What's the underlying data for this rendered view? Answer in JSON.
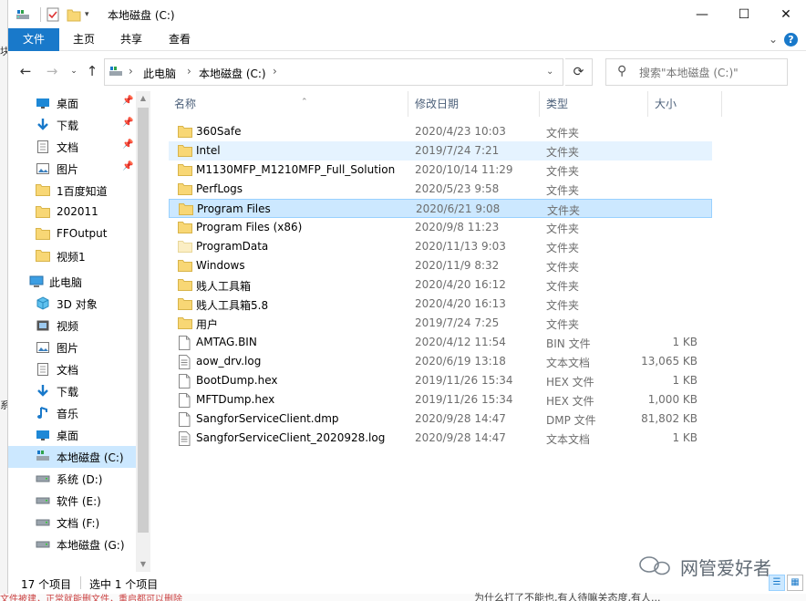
{
  "window": {
    "title": "本地磁盘 (C:)",
    "controls": {
      "minimize": "—",
      "maximize": "☐",
      "close": "✕"
    }
  },
  "ribbon": {
    "tabs": [
      "文件",
      "主页",
      "共享",
      "查看"
    ],
    "expand_glyph": "⌄",
    "help_glyph": "?"
  },
  "address": {
    "segments": [
      "此电脑",
      "本地磁盘 (C:)"
    ],
    "search_placeholder": "搜索\"本地磁盘 (C:)\""
  },
  "nav_pane": {
    "quick_access": [
      {
        "label": "桌面",
        "icon": "desktop-icon",
        "pinned": true
      },
      {
        "label": "下载",
        "icon": "download-icon",
        "pinned": true
      },
      {
        "label": "文档",
        "icon": "document-icon",
        "pinned": true
      },
      {
        "label": "图片",
        "icon": "picture-icon",
        "pinned": true
      },
      {
        "label": "1百度知道",
        "icon": "folder-icon",
        "pinned": false
      },
      {
        "label": "202011",
        "icon": "folder-icon",
        "pinned": false
      },
      {
        "label": "FFOutput",
        "icon": "folder-icon",
        "pinned": false
      },
      {
        "label": "视频1",
        "icon": "folder-icon",
        "pinned": false
      }
    ],
    "this_pc": {
      "label": "此电脑",
      "icon": "computer-icon"
    },
    "this_pc_items": [
      {
        "label": "3D 对象",
        "icon": "3d-objects-icon"
      },
      {
        "label": "视频",
        "icon": "video-icon"
      },
      {
        "label": "图片",
        "icon": "picture-icon"
      },
      {
        "label": "文档",
        "icon": "document-icon"
      },
      {
        "label": "下载",
        "icon": "download-icon"
      },
      {
        "label": "音乐",
        "icon": "music-icon"
      },
      {
        "label": "桌面",
        "icon": "desktop-icon"
      },
      {
        "label": "本地磁盘 (C:)",
        "icon": "system-drive-icon",
        "selected": true
      },
      {
        "label": "系统 (D:)",
        "icon": "drive-icon"
      },
      {
        "label": "软件 (E:)",
        "icon": "drive-icon"
      },
      {
        "label": "文档 (F:)",
        "icon": "drive-icon"
      },
      {
        "label": "本地磁盘 (G:)",
        "icon": "drive-icon"
      }
    ]
  },
  "columns": {
    "name": "名称",
    "date": "修改日期",
    "type": "类型",
    "size": "大小"
  },
  "files": [
    {
      "name": "360Safe",
      "date": "2020/4/23 10:03",
      "type": "文件夹",
      "size": "",
      "kind": "folder"
    },
    {
      "name": "Intel",
      "date": "2019/7/24 7:21",
      "type": "文件夹",
      "size": "",
      "kind": "folder",
      "state": "hover"
    },
    {
      "name": "M1130MFP_M1210MFP_Full_Solution",
      "date": "2020/10/14 11:29",
      "type": "文件夹",
      "size": "",
      "kind": "folder"
    },
    {
      "name": "PerfLogs",
      "date": "2020/5/23 9:58",
      "type": "文件夹",
      "size": "",
      "kind": "folder"
    },
    {
      "name": "Program Files",
      "date": "2020/6/21 9:08",
      "type": "文件夹",
      "size": "",
      "kind": "folder",
      "state": "selected"
    },
    {
      "name": "Program Files (x86)",
      "date": "2020/9/8 11:23",
      "type": "文件夹",
      "size": "",
      "kind": "folder"
    },
    {
      "name": "ProgramData",
      "date": "2020/11/13 9:03",
      "type": "文件夹",
      "size": "",
      "kind": "folder-hidden"
    },
    {
      "name": "Windows",
      "date": "2020/11/9 8:32",
      "type": "文件夹",
      "size": "",
      "kind": "folder"
    },
    {
      "name": "贱人工具箱",
      "date": "2020/4/20 16:12",
      "type": "文件夹",
      "size": "",
      "kind": "folder"
    },
    {
      "name": "贱人工具箱5.8",
      "date": "2020/4/20 16:13",
      "type": "文件夹",
      "size": "",
      "kind": "folder"
    },
    {
      "name": "用户",
      "date": "2019/7/24 7:25",
      "type": "文件夹",
      "size": "",
      "kind": "folder"
    },
    {
      "name": "AMTAG.BIN",
      "date": "2020/4/12 11:54",
      "type": "BIN 文件",
      "size": "1 KB",
      "kind": "file"
    },
    {
      "name": "aow_drv.log",
      "date": "2020/6/19 13:18",
      "type": "文本文档",
      "size": "13,065 KB",
      "kind": "text"
    },
    {
      "name": "BootDump.hex",
      "date": "2019/11/26 15:34",
      "type": "HEX 文件",
      "size": "1 KB",
      "kind": "file"
    },
    {
      "name": "MFTDump.hex",
      "date": "2019/11/26 15:34",
      "type": "HEX 文件",
      "size": "1,000 KB",
      "kind": "file"
    },
    {
      "name": "SangforServiceClient.dmp",
      "date": "2020/9/28 14:47",
      "type": "DMP 文件",
      "size": "81,802 KB",
      "kind": "file"
    },
    {
      "name": "SangforServiceClient_2020928.log",
      "date": "2020/9/28 14:47",
      "type": "文本文档",
      "size": "1 KB",
      "kind": "text"
    }
  ],
  "status": {
    "count": "17 个项目",
    "selection": "选中 1 个项目"
  },
  "watermark": {
    "text": "网管爱好者"
  },
  "background": {
    "left_chars": [
      "块",
      "系"
    ],
    "bottom_left": "文件被建，正常就能删文件，重启都可以删除",
    "bottom_right": "为什么打了不能也,有人待嘛关态度,有人..."
  },
  "colors": {
    "accent": "#1979ca",
    "selected_bg": "#cce8ff",
    "hover_bg": "#e5f3ff",
    "folder": "#f8d775"
  }
}
